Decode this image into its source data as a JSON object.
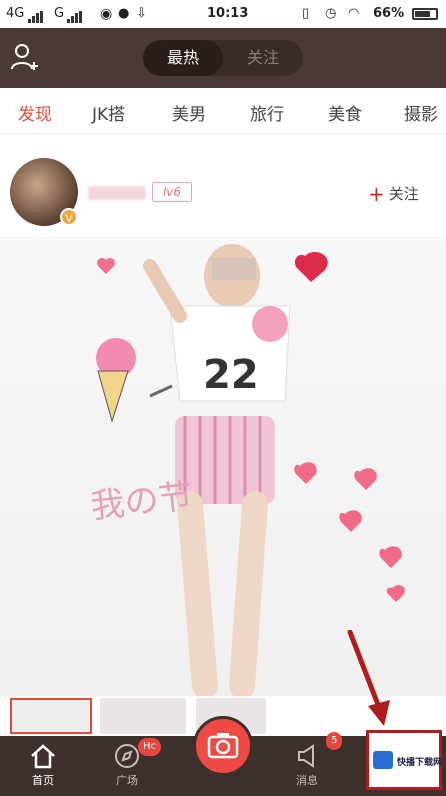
{
  "status_bar": {
    "network_left": "4G",
    "network_mid": "G",
    "time": "10:13",
    "battery": "66%"
  },
  "header": {
    "tabs": [
      {
        "label": "最热",
        "active": true
      },
      {
        "label": "关注",
        "active": false
      }
    ],
    "add_user_icon": "add-user-icon"
  },
  "categories": [
    {
      "label": "发现",
      "active": true
    },
    {
      "label": "JK搭",
      "active": false
    },
    {
      "label": "美男",
      "active": false
    },
    {
      "label": "旅行",
      "active": false
    },
    {
      "label": "美食",
      "active": false
    },
    {
      "label": "摄影",
      "active": false
    }
  ],
  "post": {
    "level": "lv6",
    "verified_badge": "V",
    "follow_label": "关注",
    "photo_jersey_number": "22",
    "photo_caption": "我の节"
  },
  "bottom_nav": [
    {
      "label": "首页",
      "icon": "home-icon",
      "active": true
    },
    {
      "label": "广场",
      "icon": "compass-icon",
      "badge": "Hc"
    },
    {
      "label": "",
      "icon": "camera-icon"
    },
    {
      "label": "消息",
      "icon": "message-icon",
      "badge": "5"
    }
  ],
  "watermark": {
    "text": "快播下载网"
  },
  "colors": {
    "accent": "#e84a3a",
    "header_bg": "#4a3a35",
    "nav_bg": "#3e302c"
  }
}
